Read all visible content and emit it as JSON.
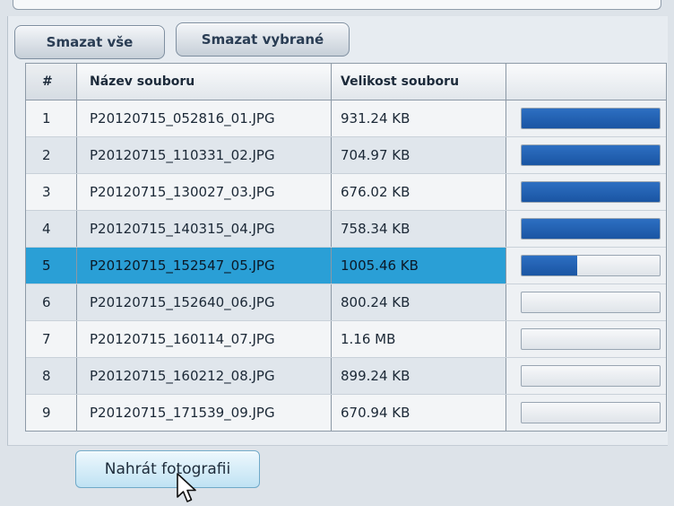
{
  "toolbar": {
    "delete_all_label": "Smazat vše",
    "delete_selected_label": "Smazat vybrané"
  },
  "table": {
    "headers": {
      "num": "#",
      "name": "Název souboru",
      "size": "Velikost souboru"
    },
    "rows": [
      {
        "num": "1",
        "name": "P20120715_052816_01.JPG",
        "size": "931.24 KB",
        "progress": 100
      },
      {
        "num": "2",
        "name": "P20120715_110331_02.JPG",
        "size": "704.97 KB",
        "progress": 100
      },
      {
        "num": "3",
        "name": "P20120715_130027_03.JPG",
        "size": "676.02 KB",
        "progress": 100
      },
      {
        "num": "4",
        "name": "P20120715_140315_04.JPG",
        "size": "758.34 KB",
        "progress": 100
      },
      {
        "num": "5",
        "name": "P20120715_152547_05.JPG",
        "size": "1005.46 KB",
        "progress": 40,
        "selected": true
      },
      {
        "num": "6",
        "name": "P20120715_152640_06.JPG",
        "size": "800.24 KB",
        "progress": 0
      },
      {
        "num": "7",
        "name": "P20120715_160114_07.JPG",
        "size": "1.16 MB",
        "progress": 0
      },
      {
        "num": "8",
        "name": "P20120715_160212_08.JPG",
        "size": "899.24 KB",
        "progress": 0
      },
      {
        "num": "9",
        "name": "P20120715_171539_09.JPG",
        "size": "670.94 KB",
        "progress": 0
      }
    ]
  },
  "upload_button_label": "Nahrát fotografii",
  "icons": {
    "cursor": "mouse-cursor-icon"
  },
  "colors": {
    "selected_row": "#2a9fd6",
    "progress_fill": "#1f5bab",
    "button_text": "#2a3d54",
    "upload_button": "#bfe2f3"
  }
}
